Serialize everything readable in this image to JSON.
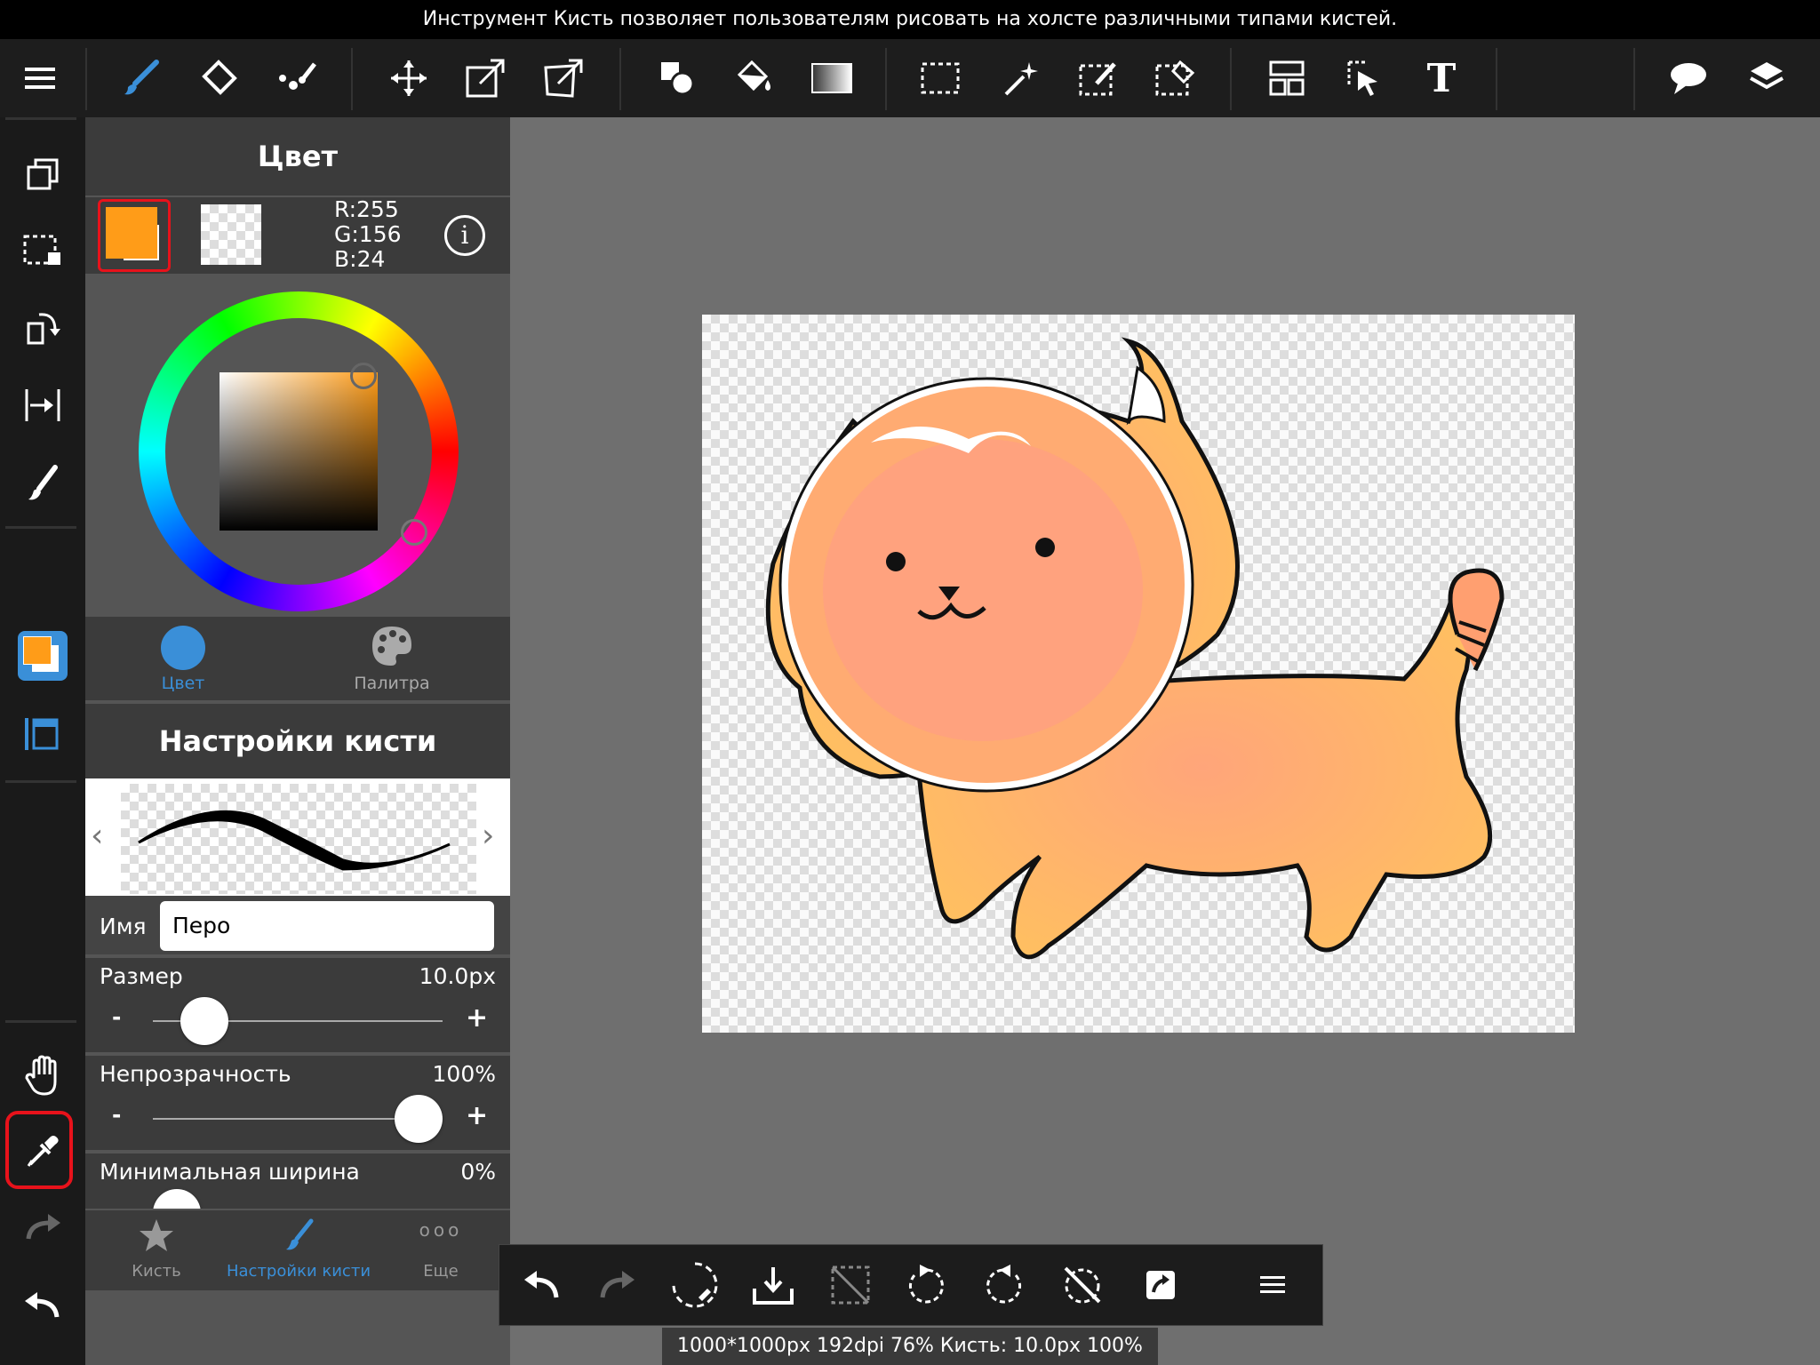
{
  "banner": {
    "text": "Инструмент Кисть позволяет пользователям рисовать на холсте различными типами кистей."
  },
  "colors": {
    "accent": "#3a8fd8",
    "primary": "#ff9c18",
    "highlight": "#e8121b"
  },
  "toolbar": {
    "icons": [
      "menu-icon",
      "brush-icon",
      "eraser-icon",
      "smudge-icon",
      "move-icon",
      "transform-icon",
      "warp-transform-icon",
      "shape-icon",
      "fill-icon",
      "gradient-icon",
      "select-rect-icon",
      "magic-wand-icon",
      "select-pen-icon",
      "select-eraser-icon",
      "layout-icon",
      "select-move-icon",
      "text-tool-icon",
      "speech-bubble-icon",
      "layers-icon"
    ],
    "text_tool_label": "T"
  },
  "sidebar": {
    "icons": [
      "copy-layer-icon",
      "select-all-icon",
      "rotate-canvas-icon",
      "flip-canvas-icon",
      "brush-shortcut-icon",
      "color-swatch-icon",
      "layer-view-icon",
      "hand-icon",
      "eyedropper-icon",
      "redo-icon",
      "undo-icon"
    ]
  },
  "color_panel": {
    "title": "Цвет",
    "r_label": "R:255",
    "g_label": "G:156",
    "b_label": "B:24",
    "info_label": "i",
    "tab_color": "Цвет",
    "tab_palette": "Палитра"
  },
  "brush_panel": {
    "title": "Настройки кисти",
    "name_label": "Имя",
    "name_value": "Перо",
    "size_label": "Размер",
    "size_value": "10.0px",
    "size_fraction": 0.2,
    "opacity_label": "Непрозрачность",
    "opacity_value": "100%",
    "opacity_fraction": 1.0,
    "minwidth_label": "Минимальная ширина",
    "minwidth_value": "0%",
    "minus": "-",
    "plus": "+"
  },
  "bottom_tabs": {
    "brush": "Кисть",
    "brush_settings": "Настройки кисти",
    "more": "Еще",
    "more_glyph": "ooo"
  },
  "bottombar": {
    "icons": [
      "undo-icon",
      "redo-icon",
      "transform-rotate-icon",
      "save-icon",
      "deselect-icon",
      "rotate-left-icon",
      "rotate-right-icon",
      "reset-rotation-icon",
      "share-icon",
      "more-menu-icon"
    ]
  },
  "status": {
    "text": "1000*1000px 192dpi 76% Кисть: 10.0px 100%"
  }
}
